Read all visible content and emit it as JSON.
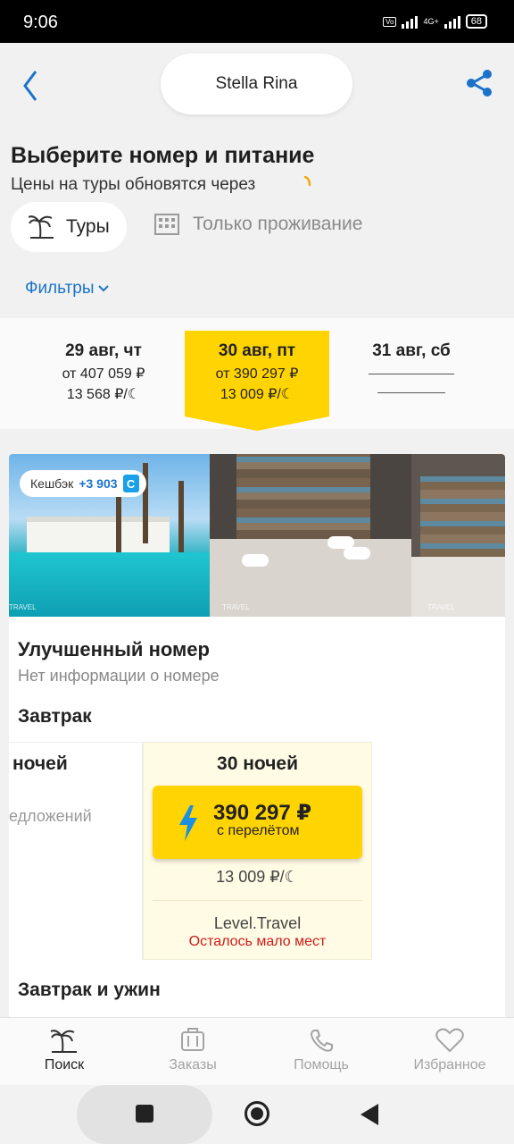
{
  "status": {
    "time": "9:06",
    "battery": "68",
    "network": "4G+"
  },
  "header": {
    "title": "Stella Rina"
  },
  "page": {
    "heading": "Выберите номер и питание",
    "subheading": "Цены на туры обновятся через"
  },
  "segments": {
    "tours": "Туры",
    "stay_only": "Только проживание"
  },
  "filters": {
    "label": "Фильтры"
  },
  "dates": [
    {
      "date": "29 авг, чт",
      "price": "от 407 059 ₽",
      "per_night": "13 568 ₽/☾"
    },
    {
      "date": "30 авг, пт",
      "price": "от 390 297 ₽",
      "per_night": "13 009 ₽/☾"
    },
    {
      "date": "31 авг, сб",
      "price": "",
      "per_night": ""
    }
  ],
  "room": {
    "cashback_label": "Кешбэк",
    "cashback_value": "+3 903",
    "cashback_icon": "С",
    "watermark": "TRAVEL",
    "title": "Улучшенный номер",
    "info": "Нет информации о номере",
    "meal_1": "Завтрак",
    "left_col": {
      "nights": "ночей",
      "offers": "едложений"
    },
    "offer": {
      "nights": "30 ночей",
      "price": "390 297 ₽",
      "price_note": "с перелётом",
      "per_night": "13 009 ₽/☾",
      "operator": "Level.Travel",
      "availability": "Осталось мало мест"
    },
    "meal_2": "Завтрак и ужин"
  },
  "tabs": [
    {
      "label": "Поиск",
      "icon": "palm-search-icon"
    },
    {
      "label": "Заказы",
      "icon": "suitcase-icon"
    },
    {
      "label": "Помощь",
      "icon": "phone-icon"
    },
    {
      "label": "Избранное",
      "icon": "heart-icon"
    }
  ],
  "colors": {
    "accent": "#ffd400",
    "link": "#1a73c9",
    "warning": "#cc1b1b"
  }
}
